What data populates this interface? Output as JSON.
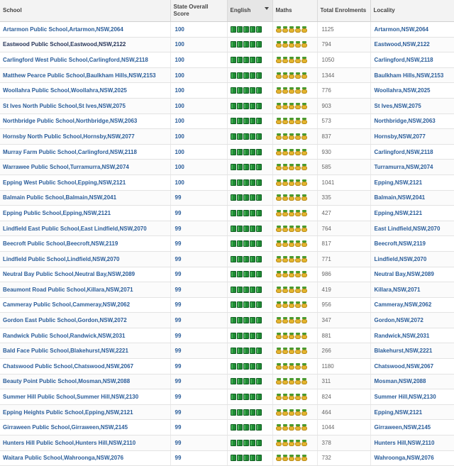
{
  "header": {
    "school": "School",
    "score": "State Overall Score",
    "english": "English",
    "maths": "Maths",
    "enrolments": "Total Enrolments",
    "locality": "Locality"
  },
  "icons": {
    "english": "book-icon",
    "maths": "pineapple-icon"
  },
  "colors": {
    "link": "#2a5d9a",
    "book": "#1f8a34",
    "pineapple": "#e4b52f"
  },
  "rows": [
    {
      "school": "Artarmon Public School,Artarmon,NSW,2064",
      "score": "100",
      "english": 5,
      "maths": 5,
      "enrolments": "1125",
      "locality": "Artarmon,NSW,2064"
    },
    {
      "school": "Eastwood Public School,Eastwood,NSW,2122",
      "score": "100",
      "english": 5,
      "maths": 5,
      "enrolments": "794",
      "locality": "Eastwood,NSW,2122"
    },
    {
      "school": "Carlingford West Public School,Carlingford,NSW,2118",
      "score": "100",
      "english": 5,
      "maths": 5,
      "enrolments": "1050",
      "locality": "Carlingford,NSW,2118"
    },
    {
      "school": "Matthew Pearce Public School,Baulkham Hills,NSW,2153",
      "score": "100",
      "english": 5,
      "maths": 5,
      "enrolments": "1344",
      "locality": "Baulkham Hills,NSW,2153"
    },
    {
      "school": "Woollahra Public School,Woollahra,NSW,2025",
      "score": "100",
      "english": 5,
      "maths": 5,
      "enrolments": "776",
      "locality": "Woollahra,NSW,2025"
    },
    {
      "school": "St Ives North Public School,St Ives,NSW,2075",
      "score": "100",
      "english": 5,
      "maths": 5,
      "enrolments": "903",
      "locality": "St Ives,NSW,2075"
    },
    {
      "school": "Northbridge Public School,Northbridge,NSW,2063",
      "score": "100",
      "english": 5,
      "maths": 5,
      "enrolments": "573",
      "locality": "Northbridge,NSW,2063"
    },
    {
      "school": "Hornsby North Public School,Hornsby,NSW,2077",
      "score": "100",
      "english": 5,
      "maths": 5,
      "enrolments": "837",
      "locality": "Hornsby,NSW,2077"
    },
    {
      "school": "Murray Farm Public School,Carlingford,NSW,2118",
      "score": "100",
      "english": 5,
      "maths": 5,
      "enrolments": "930",
      "locality": "Carlingford,NSW,2118"
    },
    {
      "school": "Warrawee Public School,Turramurra,NSW,2074",
      "score": "100",
      "english": 5,
      "maths": 5,
      "enrolments": "585",
      "locality": "Turramurra,NSW,2074"
    },
    {
      "school": "Epping West Public School,Epping,NSW,2121",
      "score": "100",
      "english": 5,
      "maths": 5,
      "enrolments": "1041",
      "locality": "Epping,NSW,2121"
    },
    {
      "school": "Balmain Public School,Balmain,NSW,2041",
      "score": "99",
      "english": 5,
      "maths": 5,
      "enrolments": "335",
      "locality": "Balmain,NSW,2041"
    },
    {
      "school": "Epping Public School,Epping,NSW,2121",
      "score": "99",
      "english": 5,
      "maths": 5,
      "enrolments": "427",
      "locality": "Epping,NSW,2121"
    },
    {
      "school": "Lindfield East Public School,East Lindfield,NSW,2070",
      "score": "99",
      "english": 5,
      "maths": 5,
      "enrolments": "764",
      "locality": "East Lindfield,NSW,2070"
    },
    {
      "school": "Beecroft Public School,Beecroft,NSW,2119",
      "score": "99",
      "english": 5,
      "maths": 5,
      "enrolments": "817",
      "locality": "Beecroft,NSW,2119"
    },
    {
      "school": "Lindfield Public School,Lindfield,NSW,2070",
      "score": "99",
      "english": 5,
      "maths": 5,
      "enrolments": "771",
      "locality": "Lindfield,NSW,2070"
    },
    {
      "school": "Neutral Bay Public School,Neutral Bay,NSW,2089",
      "score": "99",
      "english": 5,
      "maths": 5,
      "enrolments": "986",
      "locality": "Neutral Bay,NSW,2089"
    },
    {
      "school": "Beaumont Road Public School,Killara,NSW,2071",
      "score": "99",
      "english": 5,
      "maths": 5,
      "enrolments": "419",
      "locality": "Killara,NSW,2071"
    },
    {
      "school": "Cammeray Public School,Cammeray,NSW,2062",
      "score": "99",
      "english": 5,
      "maths": 5,
      "enrolments": "956",
      "locality": "Cammeray,NSW,2062"
    },
    {
      "school": "Gordon East Public School,Gordon,NSW,2072",
      "score": "99",
      "english": 5,
      "maths": 5,
      "enrolments": "347",
      "locality": "Gordon,NSW,2072"
    },
    {
      "school": "Randwick Public School,Randwick,NSW,2031",
      "score": "99",
      "english": 5,
      "maths": 5,
      "enrolments": "881",
      "locality": "Randwick,NSW,2031"
    },
    {
      "school": "Bald Face Public School,Blakehurst,NSW,2221",
      "score": "99",
      "english": 5,
      "maths": 5,
      "enrolments": "266",
      "locality": "Blakehurst,NSW,2221"
    },
    {
      "school": "Chatswood Public School,Chatswood,NSW,2067",
      "score": "99",
      "english": 5,
      "maths": 5,
      "enrolments": "1180",
      "locality": "Chatswood,NSW,2067"
    },
    {
      "school": "Beauty Point Public School,Mosman,NSW,2088",
      "score": "99",
      "english": 5,
      "maths": 5,
      "enrolments": "311",
      "locality": "Mosman,NSW,2088"
    },
    {
      "school": "Summer Hill Public School,Summer Hill,NSW,2130",
      "score": "99",
      "english": 5,
      "maths": 5,
      "enrolments": "824",
      "locality": "Summer Hill,NSW,2130"
    },
    {
      "school": "Epping Heights Public School,Epping,NSW,2121",
      "score": "99",
      "english": 5,
      "maths": 5,
      "enrolments": "464",
      "locality": "Epping,NSW,2121"
    },
    {
      "school": "Girraween Public School,Girraween,NSW,2145",
      "score": "99",
      "english": 5,
      "maths": 5,
      "enrolments": "1044",
      "locality": "Girraween,NSW,2145"
    },
    {
      "school": "Hunters Hill Public School,Hunters Hill,NSW,2110",
      "score": "99",
      "english": 5,
      "maths": 5,
      "enrolments": "378",
      "locality": "Hunters Hill,NSW,2110"
    },
    {
      "school": "Waitara Public School,Wahroonga,NSW,2076",
      "score": "99",
      "english": 5,
      "maths": 5,
      "enrolments": "732",
      "locality": "Wahroonga,NSW,2076"
    }
  ]
}
